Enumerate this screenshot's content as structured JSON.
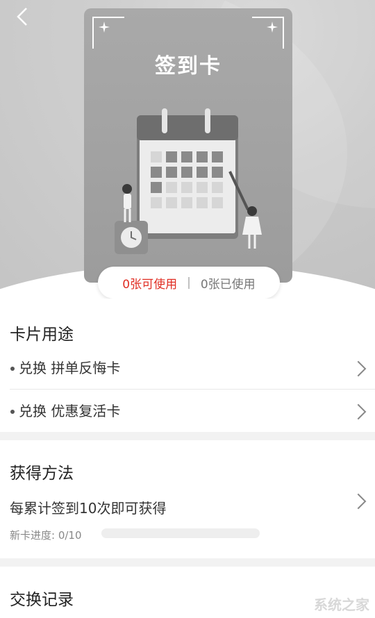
{
  "header": {
    "back_icon": "chevron-left-icon"
  },
  "card": {
    "title": "签到卡"
  },
  "status": {
    "available": "0张可使用",
    "separator": "|",
    "used": "0张已使用"
  },
  "usage": {
    "title": "卡片用途",
    "items": [
      {
        "label": "兑换 拼单反悔卡"
      },
      {
        "label": "兑换 优惠复活卡"
      }
    ]
  },
  "method": {
    "title": "获得方法",
    "description": "每累计签到10次即可获得",
    "progress_label": "新卡进度: 0/10",
    "progress_fraction": 0
  },
  "records": {
    "title": "交换记录"
  },
  "watermark": {
    "text": "系统之家"
  },
  "colors": {
    "accent": "#e02e24",
    "card_gray": "#a3a3a3"
  }
}
